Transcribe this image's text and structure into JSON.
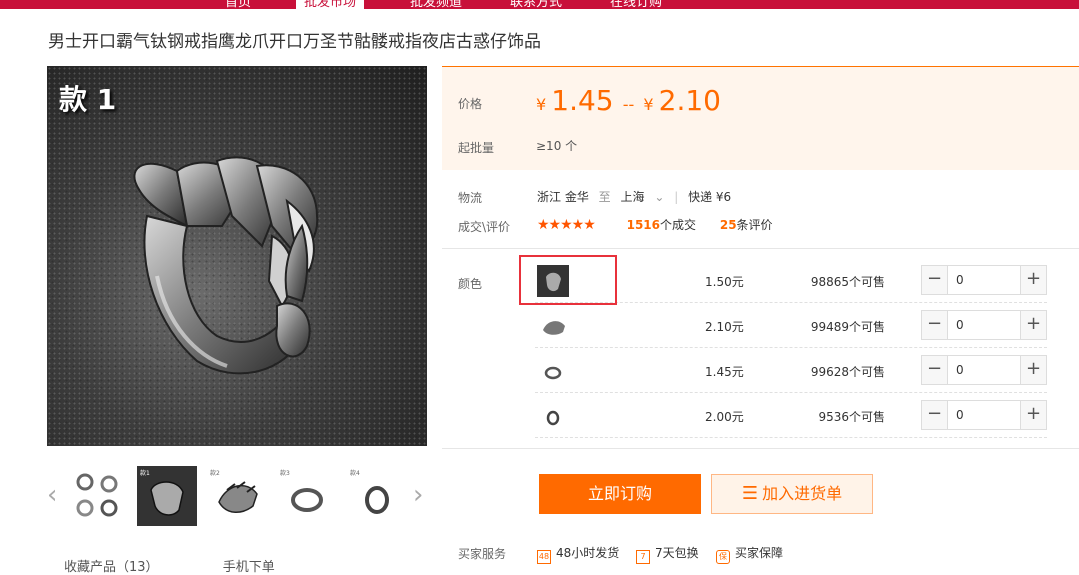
{
  "nav": [
    "首页",
    "批发市场",
    "批发频道",
    "联系方式",
    "在线订购"
  ],
  "product_title": "男士开口霸气钛钢戒指鹰龙爪开口万圣节骷髅戒指夜店古惑仔饰品",
  "main_image_label": "款 1",
  "thumb_labels": [
    "款1",
    "款2",
    "款3",
    "款4"
  ],
  "price": {
    "label": "价格",
    "currency": "¥",
    "low": "1.45",
    "sep": "--",
    "high": "2.10"
  },
  "moq": {
    "label": "起批量",
    "value": "≥10 个"
  },
  "logistics": {
    "label": "物流",
    "from": "浙江 金华",
    "to_word": "至",
    "to": "上海",
    "sep": "|",
    "express": "快递 ¥6"
  },
  "trade": {
    "label": "成交\\评价",
    "stars": "★★★★★",
    "deals_count": "1516",
    "deals_suffix": "个成交",
    "reviews_count": "25",
    "reviews_suffix": "条评价"
  },
  "sku": {
    "label": "颜色",
    "rows": [
      {
        "price": "1.50元",
        "stock": "98865个可售",
        "qty": "0"
      },
      {
        "price": "2.10元",
        "stock": "99489个可售",
        "qty": "0"
      },
      {
        "price": "1.45元",
        "stock": "99628个可售",
        "qty": "0"
      },
      {
        "price": "2.00元",
        "stock": "9536个可售",
        "qty": "0"
      }
    ]
  },
  "buttons": {
    "buy": "立即订购",
    "cart": "加入进货单"
  },
  "services": {
    "label": "买家服务",
    "items": [
      {
        "icon": "48h-icon",
        "glyph": "48",
        "text": "48小时发货"
      },
      {
        "icon": "7day-icon",
        "glyph": "7",
        "text": "7天包换"
      },
      {
        "icon": "shield-icon",
        "glyph": "保",
        "text": "买家保障"
      }
    ]
  },
  "bottom_links": {
    "favorite": "收藏产品（13）",
    "mobile": "手机下单"
  },
  "colors": {
    "accent": "#ff6a00",
    "brand": "#c8103a",
    "highlight": "#e8313b"
  }
}
